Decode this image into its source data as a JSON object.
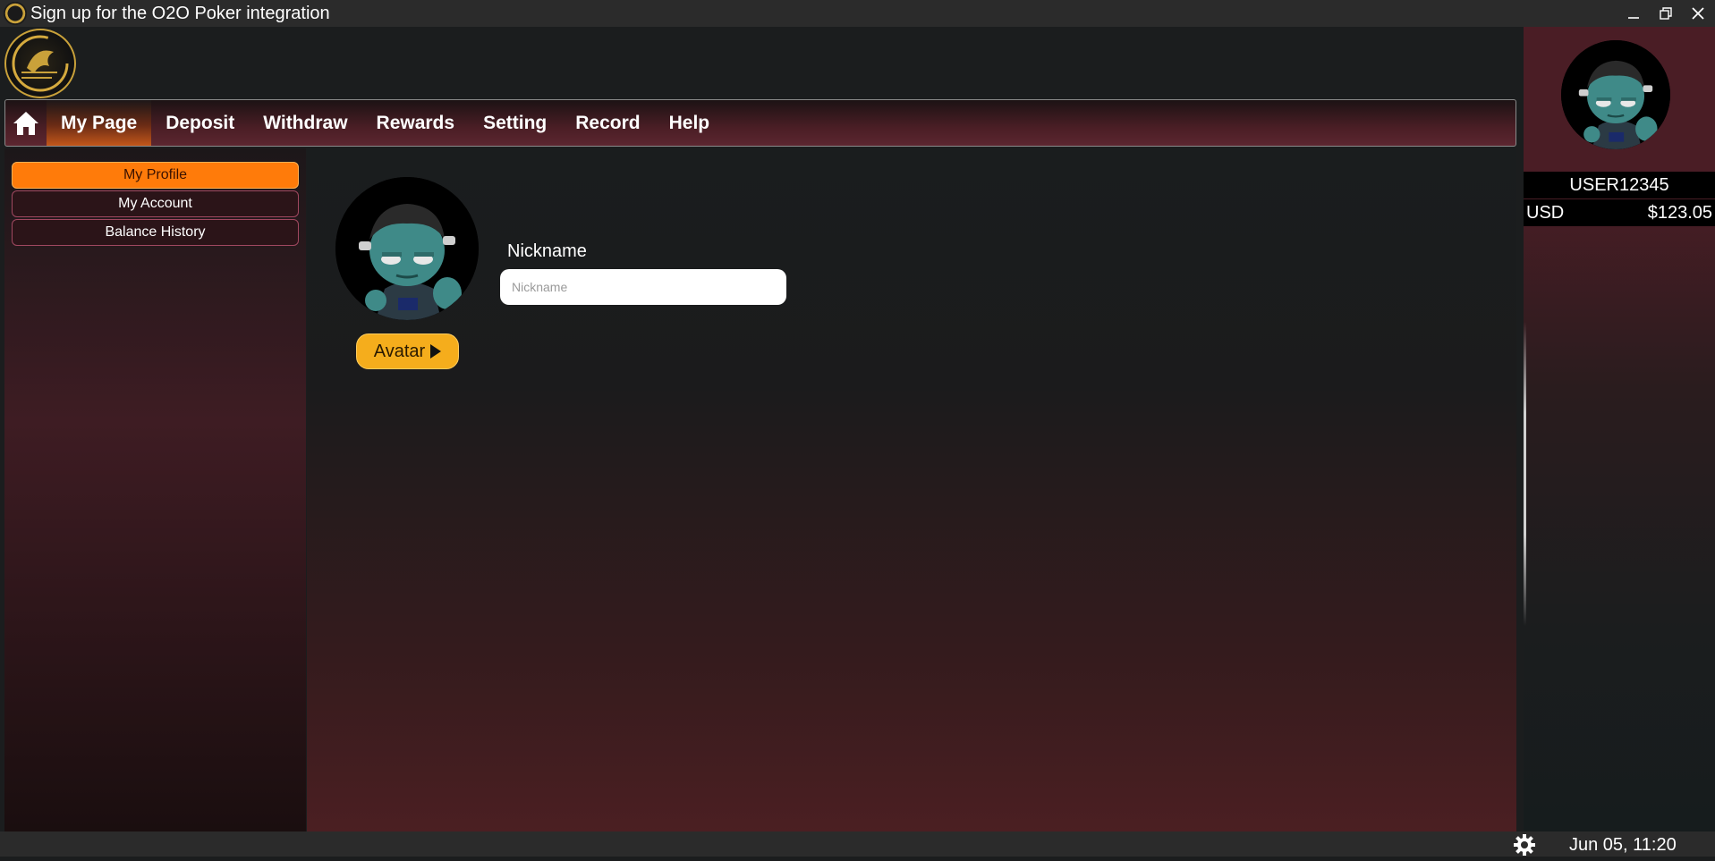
{
  "window": {
    "title": "Sign up for the O2O Poker integration",
    "controls": [
      "minimize-icon",
      "restore-icon",
      "close-icon"
    ]
  },
  "logo": {
    "icon": "dragon-asia-gaming-logo",
    "color": "#c9a13a"
  },
  "nav": {
    "home_icon": "home-icon",
    "items": [
      {
        "label": "My Page",
        "active": true
      },
      {
        "label": "Deposit"
      },
      {
        "label": "Withdraw"
      },
      {
        "label": "Rewards"
      },
      {
        "label": "Setting"
      },
      {
        "label": "Record"
      },
      {
        "label": "Help"
      }
    ]
  },
  "sidebar": {
    "items": [
      {
        "label": "My Profile",
        "active": true
      },
      {
        "label": "My Account"
      },
      {
        "label": "Balance History"
      }
    ]
  },
  "profile": {
    "avatar_button": "Avatar",
    "nickname_label": "Nickname",
    "nickname_placeholder": "Nickname",
    "nickname_value": ""
  },
  "account": {
    "username": "USER12345",
    "currency": "USD",
    "balance": "$123.05"
  },
  "status": {
    "datetime": "Jun 05, 11:20",
    "settings_icon": "gear-icon"
  },
  "colors": {
    "accent_orange": "#ff7b0a",
    "button_yellow": "#f5ad1c",
    "nav_maroon": "#5c2630"
  }
}
